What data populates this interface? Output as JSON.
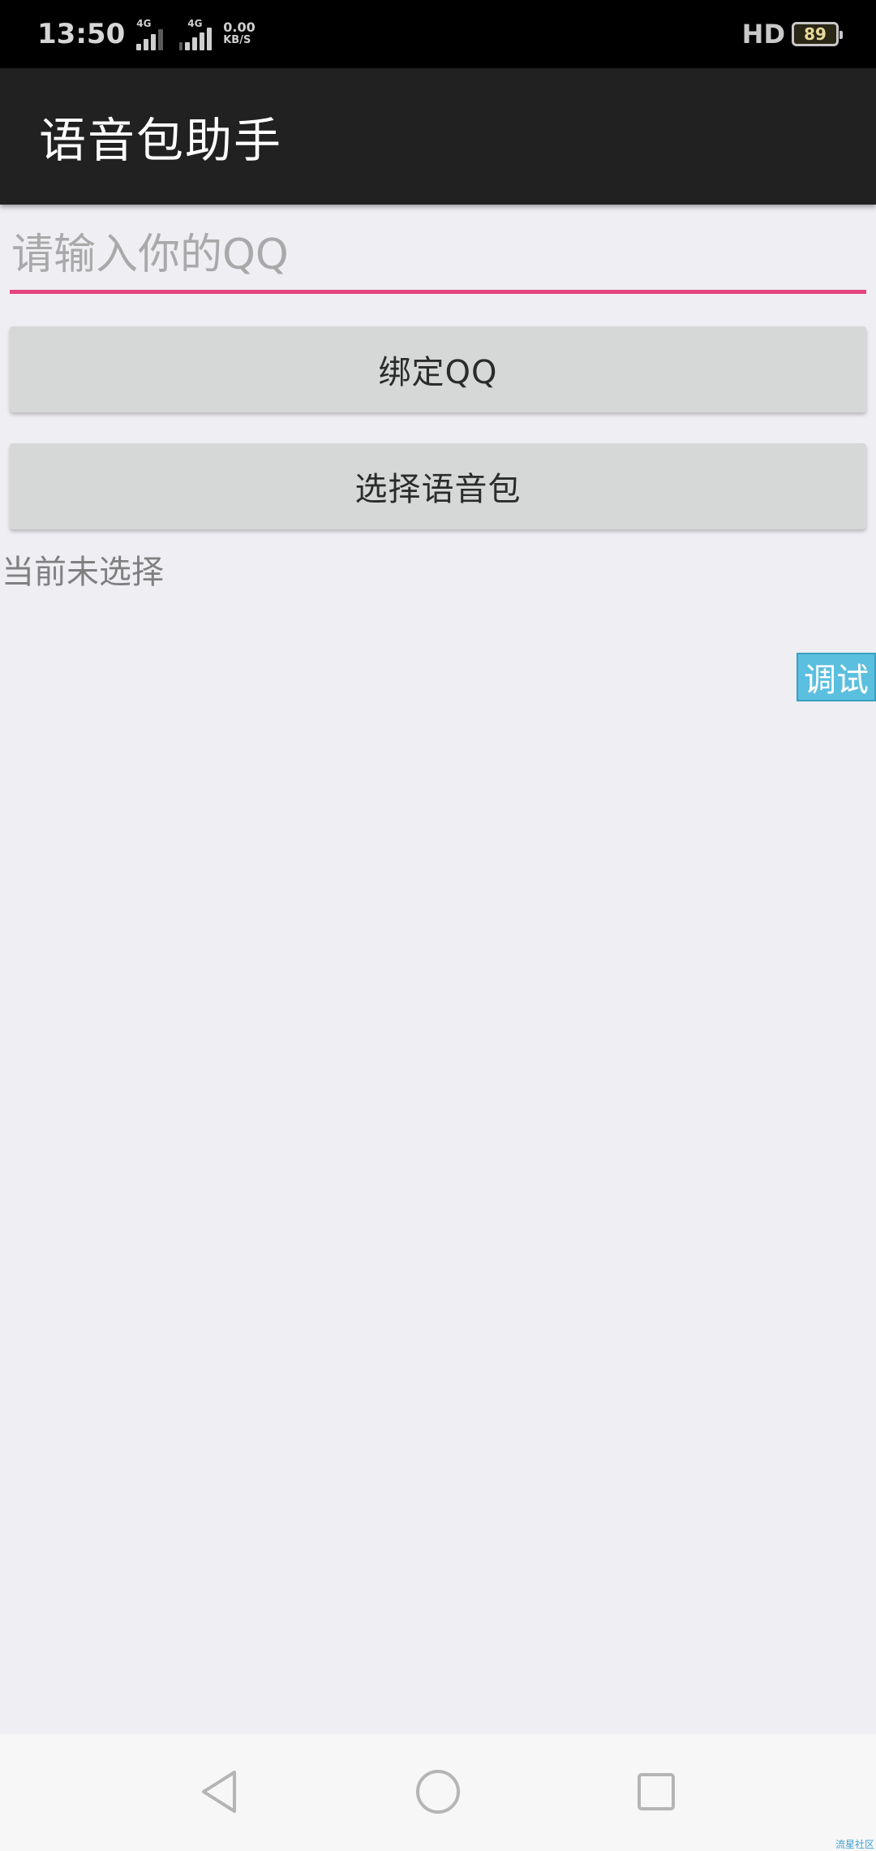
{
  "status_bar": {
    "time": "13:50",
    "sim1_label": "4G",
    "sim2_label": "4G",
    "speed_value": "0.00",
    "speed_unit": "KB/S",
    "hd_label": "HD",
    "battery_level": "89"
  },
  "app_bar": {
    "title": "语音包助手"
  },
  "form": {
    "qq_input_placeholder": "请输入你的QQ",
    "qq_input_value": "",
    "bind_button_label": "绑定QQ",
    "select_button_label": "选择语音包",
    "current_selection_text": "当前未选择"
  },
  "debug": {
    "label": "调试"
  },
  "colors": {
    "accent_underline": "#e5447f",
    "app_bar_bg": "#212121",
    "button_bg": "#d6d7d7",
    "debug_bg": "#5bbfdf",
    "page_bg": "#efeef3"
  },
  "icons": {
    "nav_back": "triangle-back-icon",
    "nav_home": "circle-home-icon",
    "nav_recent": "square-recent-icon"
  },
  "watermark": "流星社区"
}
